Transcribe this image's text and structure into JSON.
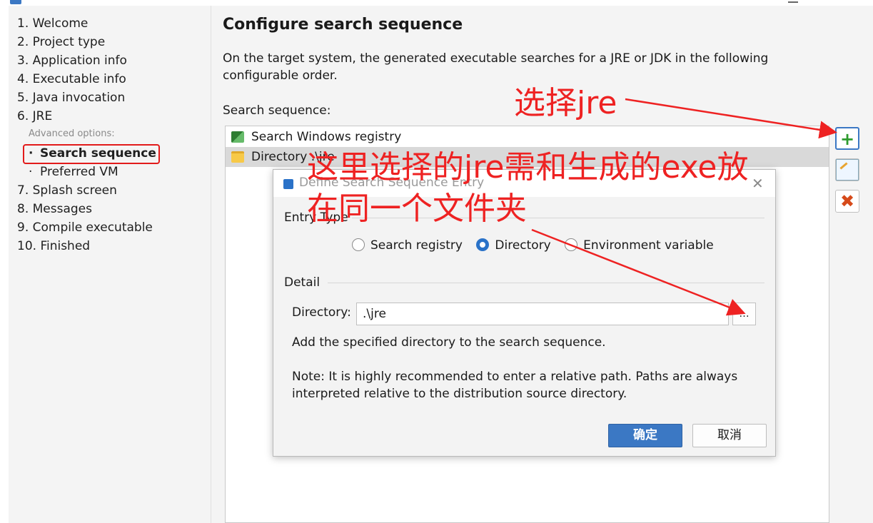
{
  "window": {
    "app_icon": "app-icon"
  },
  "sidebar": {
    "items": [
      {
        "label": "1. Welcome"
      },
      {
        "label": "2. Project type"
      },
      {
        "label": "3. Application info"
      },
      {
        "label": "4. Executable info"
      },
      {
        "label": "5. Java invocation"
      },
      {
        "label": "6. JRE"
      },
      {
        "label": "Advanced options:"
      },
      {
        "label": "Search sequence",
        "selected": true
      },
      {
        "label": "Preferred VM"
      },
      {
        "label": "7. Splash screen"
      },
      {
        "label": "8. Messages"
      },
      {
        "label": "9. Compile executable"
      },
      {
        "label": "10. Finished"
      }
    ],
    "bullet": "·"
  },
  "main": {
    "title": "Configure search sequence",
    "description": "On the target system, the generated executable searches for a JRE or JDK in the following configurable order.",
    "sequence_label": "Search sequence:",
    "sequence": [
      {
        "icon": "registry-icon",
        "label": "Search Windows registry"
      },
      {
        "icon": "folder-icon",
        "label": "Directory .\\jre",
        "selected": true
      }
    ],
    "buttons": {
      "add": "+",
      "edit": "edit-icon",
      "remove": "✖"
    }
  },
  "dialog": {
    "title": "Define Search Sequence Entry",
    "close": "✕",
    "entry_type_label": "Entry Type",
    "options": [
      {
        "label": "Search registry",
        "checked": false
      },
      {
        "label": "Directory",
        "checked": true
      },
      {
        "label": "Environment variable",
        "checked": false
      }
    ],
    "detail_label": "Detail",
    "directory_label": "Directory:",
    "directory_value": ".\\jre",
    "browse_label": "...",
    "hint": "Add the specified directory to the search sequence.",
    "note": "Note: It is highly recommended to enter a relative path. Paths are always interpreted relative to the distribution source directory.",
    "ok": "确定",
    "cancel": "取消"
  },
  "annotations": {
    "select_jre": "选择jre",
    "same_folder_line1": "这里选择的jre需和生成的exe放",
    "same_folder_line2": "在同一个文件夹",
    "color": "#ee2222"
  },
  "colors": {
    "accent": "#3b78c4",
    "selection_border": "#e21b1b"
  }
}
